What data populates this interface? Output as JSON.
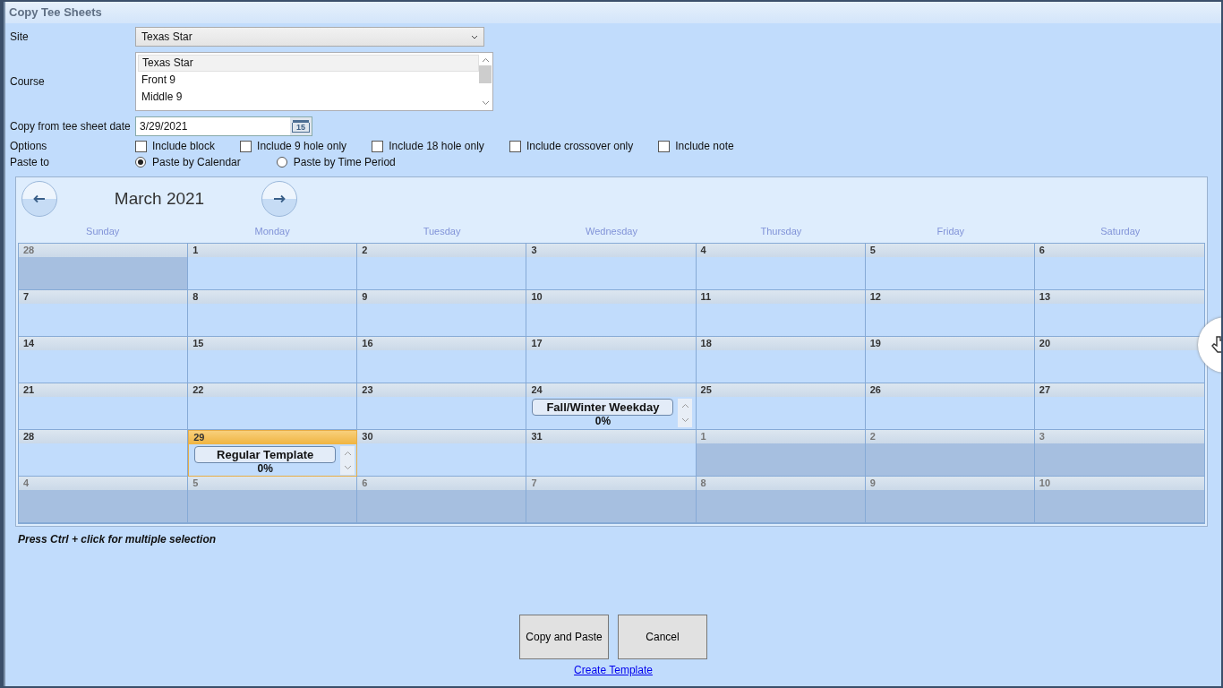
{
  "window": {
    "title": "Copy Tee Sheets"
  },
  "site": {
    "label": "Site",
    "value": "Texas Star"
  },
  "course": {
    "label": "Course",
    "items": [
      {
        "label": "Texas Star",
        "selected": true
      },
      {
        "label": "Front 9",
        "selected": false
      },
      {
        "label": "Middle 9",
        "selected": false
      }
    ]
  },
  "copy_date": {
    "label": "Copy from tee sheet date",
    "value": "3/29/2021",
    "calendar_icon_text": "15"
  },
  "options": {
    "label": "Options",
    "items": [
      {
        "label": "Include block",
        "checked": false
      },
      {
        "label": "Include 9 hole only",
        "checked": false
      },
      {
        "label": "Include 18 hole only",
        "checked": false
      },
      {
        "label": "Include crossover only",
        "checked": false
      },
      {
        "label": "Include note",
        "checked": false
      }
    ]
  },
  "paste_to": {
    "label": "Paste to",
    "items": [
      {
        "label": "Paste by Calendar",
        "selected": true
      },
      {
        "label": "Paste by Time Period",
        "selected": false
      }
    ]
  },
  "calendar": {
    "month": "March 2021",
    "weekdays": [
      "Sunday",
      "Monday",
      "Tuesday",
      "Wednesday",
      "Thursday",
      "Friday",
      "Saturday"
    ],
    "weeks": [
      [
        {
          "day": "28",
          "outside": true,
          "selected": false
        },
        {
          "day": "1",
          "outside": false,
          "selected": false
        },
        {
          "day": "2",
          "outside": false,
          "selected": false
        },
        {
          "day": "3",
          "outside": false,
          "selected": false
        },
        {
          "day": "4",
          "outside": false,
          "selected": false
        },
        {
          "day": "5",
          "outside": false,
          "selected": false
        },
        {
          "day": "6",
          "outside": false,
          "selected": false
        }
      ],
      [
        {
          "day": "7",
          "outside": false,
          "selected": false
        },
        {
          "day": "8",
          "outside": false,
          "selected": false
        },
        {
          "day": "9",
          "outside": false,
          "selected": false
        },
        {
          "day": "10",
          "outside": false,
          "selected": false
        },
        {
          "day": "11",
          "outside": false,
          "selected": false
        },
        {
          "day": "12",
          "outside": false,
          "selected": false
        },
        {
          "day": "13",
          "outside": false,
          "selected": false
        }
      ],
      [
        {
          "day": "14",
          "outside": false,
          "selected": false
        },
        {
          "day": "15",
          "outside": false,
          "selected": false
        },
        {
          "day": "16",
          "outside": false,
          "selected": false
        },
        {
          "day": "17",
          "outside": false,
          "selected": false
        },
        {
          "day": "18",
          "outside": false,
          "selected": false
        },
        {
          "day": "19",
          "outside": false,
          "selected": false
        },
        {
          "day": "20",
          "outside": false,
          "selected": false
        }
      ],
      [
        {
          "day": "21",
          "outside": false,
          "selected": false
        },
        {
          "day": "22",
          "outside": false,
          "selected": false
        },
        {
          "day": "23",
          "outside": false,
          "selected": false
        },
        {
          "day": "24",
          "outside": false,
          "selected": false,
          "event": {
            "name": "Fall/Winter Weekday",
            "progress": "0%"
          }
        },
        {
          "day": "25",
          "outside": false,
          "selected": false
        },
        {
          "day": "26",
          "outside": false,
          "selected": false
        },
        {
          "day": "27",
          "outside": false,
          "selected": false
        }
      ],
      [
        {
          "day": "28",
          "outside": false,
          "selected": false
        },
        {
          "day": "29",
          "outside": false,
          "selected": true,
          "event": {
            "name": "Regular Template",
            "progress": "0%"
          }
        },
        {
          "day": "30",
          "outside": false,
          "selected": false
        },
        {
          "day": "31",
          "outside": false,
          "selected": false
        },
        {
          "day": "1",
          "outside": true,
          "selected": false
        },
        {
          "day": "2",
          "outside": true,
          "selected": false
        },
        {
          "day": "3",
          "outside": true,
          "selected": false
        }
      ],
      [
        {
          "day": "4",
          "outside": true,
          "selected": false
        },
        {
          "day": "5",
          "outside": true,
          "selected": false
        },
        {
          "day": "6",
          "outside": true,
          "selected": false
        },
        {
          "day": "7",
          "outside": true,
          "selected": false
        },
        {
          "day": "8",
          "outside": true,
          "selected": false
        },
        {
          "day": "9",
          "outside": true,
          "selected": false
        },
        {
          "day": "10",
          "outside": true,
          "selected": false
        }
      ]
    ]
  },
  "hint": "Press Ctrl + click for multiple selection",
  "buttons": [
    "Copy and Paste",
    "Cancel"
  ],
  "link": "Create Template"
}
